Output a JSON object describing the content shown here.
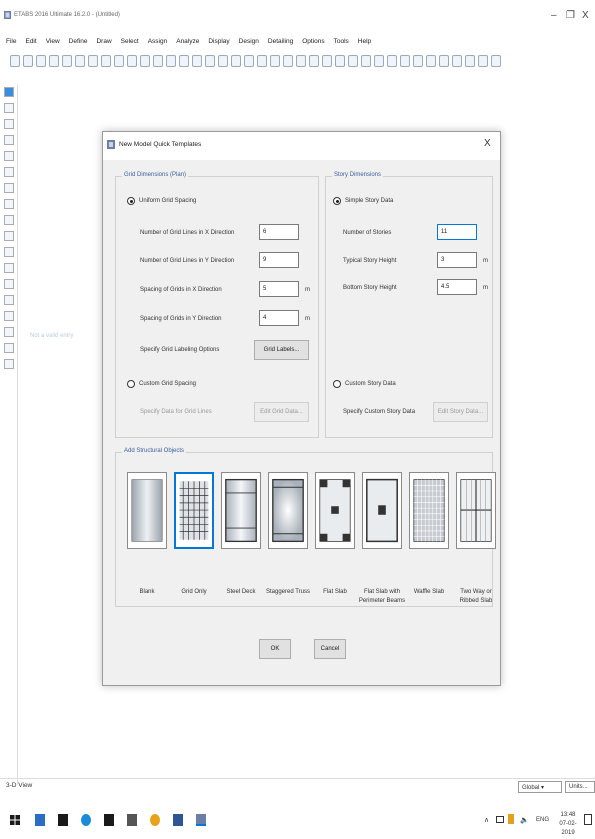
{
  "app": {
    "title": "ETABS 2016 Ultimate 16.2.0 - (Untitled)"
  },
  "menu": [
    "File",
    "Edit",
    "View",
    "Define",
    "Draw",
    "Select",
    "Assign",
    "Analyze",
    "Display",
    "Design",
    "Detailing",
    "Options",
    "Tools",
    "Help"
  ],
  "dialog": {
    "title": "New Model Quick Templates",
    "close": "X",
    "grid": {
      "title": "Grid Dimensions (Plan)",
      "uniform_label": "Uniform Grid Spacing",
      "fields": [
        {
          "label": "Number of Grid Lines in X Direction",
          "value": "6",
          "unit": ""
        },
        {
          "label": "Number of Grid Lines in Y Direction",
          "value": "9",
          "unit": ""
        },
        {
          "label": "Spacing of Grids in X Direction",
          "value": "5",
          "unit": "m"
        },
        {
          "label": "Spacing of Grids in Y Direction",
          "value": "4",
          "unit": "m"
        }
      ],
      "labeling_label": "Specify Grid Labeling Options",
      "labels_button": "Grid Labels...",
      "custom_label": "Custom Grid Spacing",
      "custom_data_label": "Specify Data for Grid Lines",
      "edit_button": "Edit Grid Data..."
    },
    "story": {
      "title": "Story Dimensions",
      "simple_label": "Simple Story Data",
      "fields": [
        {
          "label": "Number of Stories",
          "value": "11",
          "unit": ""
        },
        {
          "label": "Typical Story Height",
          "value": "3",
          "unit": "m"
        },
        {
          "label": "Bottom Story Height",
          "value": "4.5",
          "unit": "m"
        }
      ],
      "custom_label": "Custom Story Data",
      "custom_data_label": "Specify Custom Story Data",
      "edit_button": "Edit Story Data..."
    },
    "objects": {
      "title": "Add Structural Objects",
      "templates": [
        {
          "line1": "Blank",
          "line2": ""
        },
        {
          "line1": "Grid Only",
          "line2": ""
        },
        {
          "line1": "Steel Deck",
          "line2": ""
        },
        {
          "line1": "Staggered Truss",
          "line2": ""
        },
        {
          "line1": "Flat Slab",
          "line2": ""
        },
        {
          "line1": "Flat Slab with",
          "line2": "Perimeter Beams"
        },
        {
          "line1": "Waffle Slab",
          "line2": ""
        },
        {
          "line1": "Two Way or",
          "line2": "Ribbed Slab"
        }
      ]
    },
    "ok": "OK",
    "cancel": "Cancel"
  },
  "status": {
    "view": "3-D View",
    "coord": "Global",
    "units": "Units..."
  },
  "tray": {
    "lang": "ENG",
    "time": "13:48",
    "date": "07-02-2019"
  }
}
